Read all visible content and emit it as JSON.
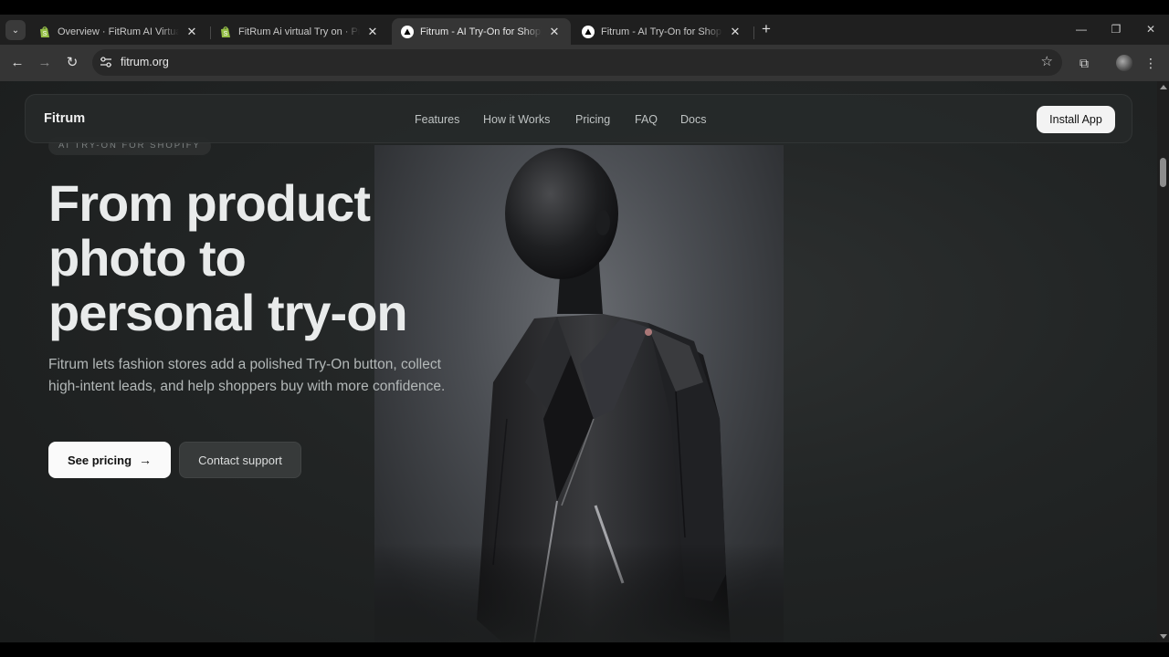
{
  "browser": {
    "tabs": [
      {
        "title": "Overview · FitRum AI Virtual Try",
        "favicon": "shopify-icon"
      },
      {
        "title": "FitRum Ai virtual Try on · Privacy",
        "favicon": "shopify-icon"
      },
      {
        "title": "Fitrum - AI Try-On for Shopify F",
        "favicon": "triangle-icon",
        "active": true
      },
      {
        "title": "Fitrum - AI Try-On for Shopify F",
        "favicon": "triangle-icon"
      }
    ],
    "new_tab": "+",
    "address": "fitrum.org",
    "icons": {
      "back": "←",
      "forward": "→",
      "reload": "↻",
      "star": "☆",
      "extensions": "⧉",
      "menu": "⋮",
      "minimize": "—",
      "restore": "❐",
      "close": "✕",
      "tab_close": "✕",
      "tab_search": "⌄"
    }
  },
  "site": {
    "logo": "Fitrum",
    "nav": [
      "Features",
      "How it Works",
      "Pricing",
      "FAQ",
      "Docs"
    ],
    "install_label": "Install App",
    "eyebrow": "AI TRY-ON FOR SHOPIFY",
    "headline": [
      "From product",
      "photo to",
      "personal try-on"
    ],
    "subtext": "Fitrum lets fashion stores add a polished Try-On button, collect high-intent leads, and help shoppers buy with more confidence.",
    "primary_label": "See pricing",
    "primary_arrow": "→",
    "secondary_label": "Contact support"
  },
  "colors": {
    "accent": "#f3f3f3",
    "background": "#222525",
    "shopify_green": "#95bf47"
  }
}
